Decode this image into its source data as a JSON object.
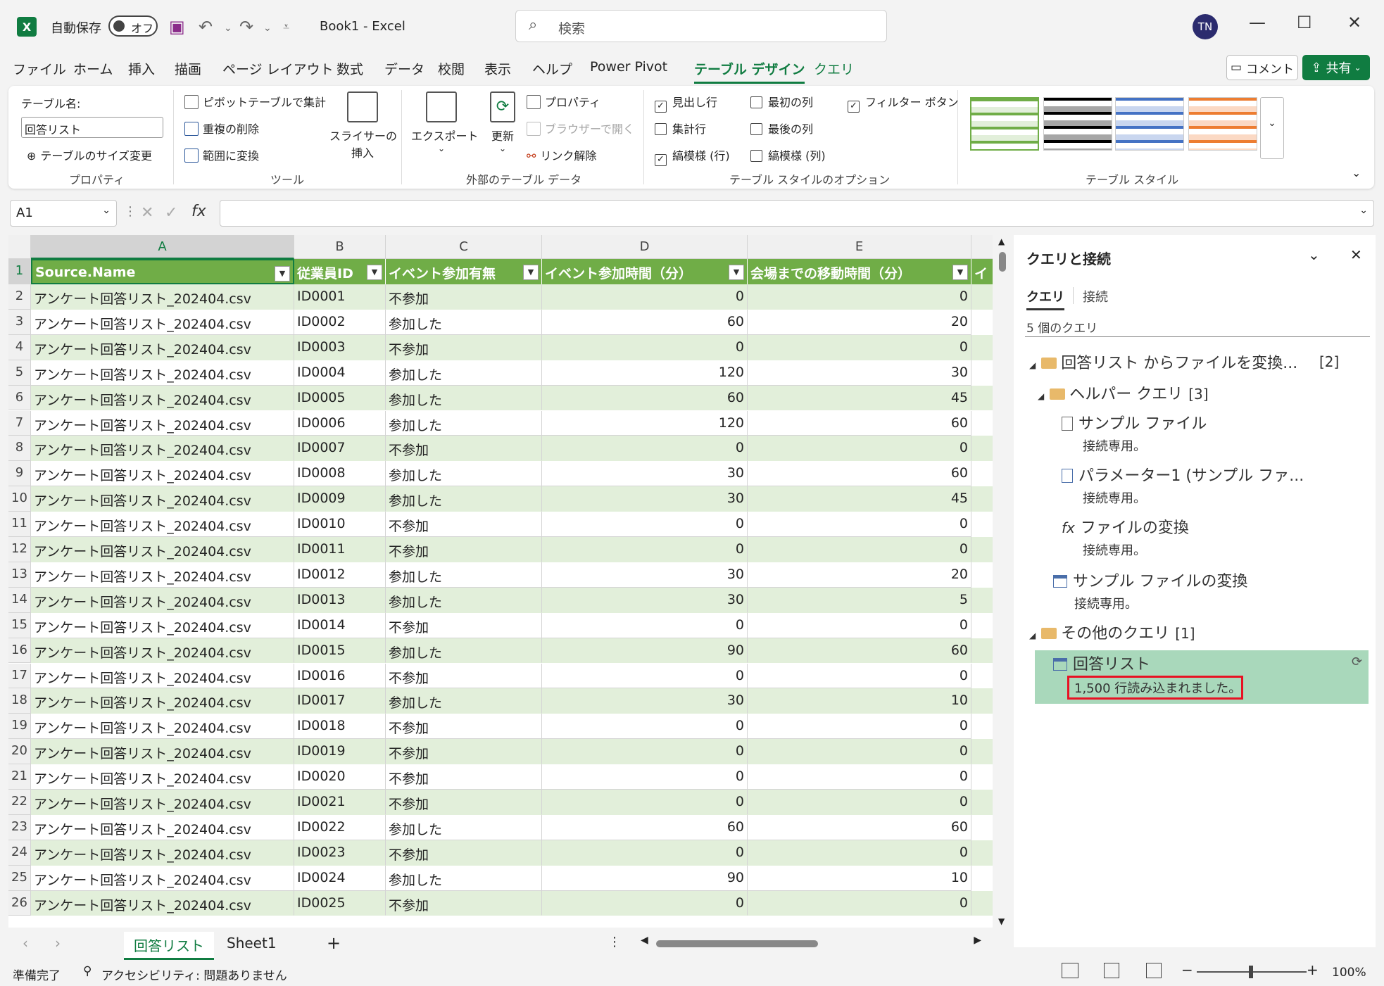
{
  "titlebar": {
    "app_badge": "X",
    "autosave_label": "自動保存",
    "autosave_state": "オフ",
    "doc_title": "Book1  -  Excel",
    "search_placeholder": "検索",
    "user_initials": "TN"
  },
  "menu_tabs": [
    "ファイル",
    "ホーム",
    "挿入",
    "描画",
    "ページ レイアウト",
    "数式",
    "データ",
    "校閲",
    "表示",
    "ヘルプ",
    "Power Pivot",
    "テーブル デザイン",
    "クエリ"
  ],
  "menu_active": "テーブル デザイン",
  "actions": {
    "comment": "コメント",
    "share": "共有"
  },
  "ribbon": {
    "properties": {
      "table_name_label": "テーブル名:",
      "table_name_value": "回答リスト",
      "resize": "テーブルのサイズ変更",
      "group": "プロパティ"
    },
    "tools": {
      "pivot": "ピボットテーブルで集計",
      "remove_dup": "重複の削除",
      "convert": "範囲に変換",
      "slicer_line1": "スライサーの",
      "slicer_line2": "挿入",
      "group": "ツール"
    },
    "external": {
      "export": "エクスポート",
      "refresh": "更新",
      "properties": "プロパティ",
      "open_browser": "ブラウザーで開く",
      "unlink": "リンク解除",
      "group": "外部のテーブル データ"
    },
    "style_options": {
      "header_row": "見出し行",
      "total_row": "集計行",
      "banded_rows": "縞模様 (行)",
      "first_col": "最初の列",
      "last_col": "最後の列",
      "banded_cols": "縞模様 (列)",
      "filter_button": "フィルター ボタン",
      "group": "テーブル スタイルのオプション"
    },
    "styles_group": "テーブル スタイル"
  },
  "formula_bar": {
    "name_box": "A1",
    "fx": "fx",
    "value": ""
  },
  "grid": {
    "columns": [
      "A",
      "B",
      "C",
      "D",
      "E"
    ],
    "headers": [
      "Source.Name",
      "従業員ID",
      "イベント参加有無",
      "イベント参加時間（分）",
      "会場までの移動時間（分）",
      "イ"
    ],
    "rows": [
      [
        "2",
        "アンケート回答リスト_202404.csv",
        "ID0001",
        "不参加",
        "0",
        "0"
      ],
      [
        "3",
        "アンケート回答リスト_202404.csv",
        "ID0002",
        "参加した",
        "60",
        "20"
      ],
      [
        "4",
        "アンケート回答リスト_202404.csv",
        "ID0003",
        "不参加",
        "0",
        "0"
      ],
      [
        "5",
        "アンケート回答リスト_202404.csv",
        "ID0004",
        "参加した",
        "120",
        "30"
      ],
      [
        "6",
        "アンケート回答リスト_202404.csv",
        "ID0005",
        "参加した",
        "60",
        "45"
      ],
      [
        "7",
        "アンケート回答リスト_202404.csv",
        "ID0006",
        "参加した",
        "120",
        "60"
      ],
      [
        "8",
        "アンケート回答リスト_202404.csv",
        "ID0007",
        "不参加",
        "0",
        "0"
      ],
      [
        "9",
        "アンケート回答リスト_202404.csv",
        "ID0008",
        "参加した",
        "30",
        "60"
      ],
      [
        "10",
        "アンケート回答リスト_202404.csv",
        "ID0009",
        "参加した",
        "30",
        "45"
      ],
      [
        "11",
        "アンケート回答リスト_202404.csv",
        "ID0010",
        "不参加",
        "0",
        "0"
      ],
      [
        "12",
        "アンケート回答リスト_202404.csv",
        "ID0011",
        "不参加",
        "0",
        "0"
      ],
      [
        "13",
        "アンケート回答リスト_202404.csv",
        "ID0012",
        "参加した",
        "30",
        "20"
      ],
      [
        "14",
        "アンケート回答リスト_202404.csv",
        "ID0013",
        "参加した",
        "30",
        "5"
      ],
      [
        "15",
        "アンケート回答リスト_202404.csv",
        "ID0014",
        "不参加",
        "0",
        "0"
      ],
      [
        "16",
        "アンケート回答リスト_202404.csv",
        "ID0015",
        "参加した",
        "90",
        "60"
      ],
      [
        "17",
        "アンケート回答リスト_202404.csv",
        "ID0016",
        "不参加",
        "0",
        "0"
      ],
      [
        "18",
        "アンケート回答リスト_202404.csv",
        "ID0017",
        "参加した",
        "30",
        "10"
      ],
      [
        "19",
        "アンケート回答リスト_202404.csv",
        "ID0018",
        "不参加",
        "0",
        "0"
      ],
      [
        "20",
        "アンケート回答リスト_202404.csv",
        "ID0019",
        "不参加",
        "0",
        "0"
      ],
      [
        "21",
        "アンケート回答リスト_202404.csv",
        "ID0020",
        "不参加",
        "0",
        "0"
      ],
      [
        "22",
        "アンケート回答リスト_202404.csv",
        "ID0021",
        "不参加",
        "0",
        "0"
      ],
      [
        "23",
        "アンケート回答リスト_202404.csv",
        "ID0022",
        "参加した",
        "60",
        "60"
      ],
      [
        "24",
        "アンケート回答リスト_202404.csv",
        "ID0023",
        "不参加",
        "0",
        "0"
      ],
      [
        "25",
        "アンケート回答リスト_202404.csv",
        "ID0024",
        "参加した",
        "90",
        "10"
      ],
      [
        "26",
        "アンケート回答リスト_202404.csv",
        "ID0025",
        "不参加",
        "0",
        "0"
      ]
    ]
  },
  "sheets": [
    "回答リスト",
    "Sheet1"
  ],
  "active_sheet": "回答リスト",
  "status": {
    "ready": "準備完了",
    "accessibility": "アクセシビリティ: 問題ありません",
    "zoom": "100%"
  },
  "query_pane": {
    "title": "クエリと接続",
    "tab_queries": "クエリ",
    "tab_connections": "接続",
    "count": "5 個のクエリ",
    "folder1": "回答リスト からファイルを変換...",
    "folder1_count": "[2]",
    "folder2": "ヘルパー クエリ",
    "folder2_count": "[3]",
    "q1": "サンプル ファイル",
    "q2": "パラメーター1 (サンプル ファ...",
    "q3": "ファイルの変換",
    "q4": "サンプル ファイルの変換",
    "conn_only": "接続専用。",
    "folder3": "その他のクエリ",
    "folder3_count": "[1]",
    "q5": "回答リスト",
    "q5_status": "1,500 行読み込まれました。"
  },
  "colors": {
    "accent": "#107c41",
    "table_header": "#70ad47",
    "band": "#e2efda",
    "highlight": "#e81123"
  }
}
